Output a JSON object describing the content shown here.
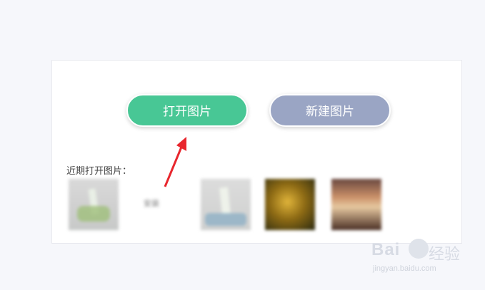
{
  "buttons": {
    "open_label": "打开图片",
    "open_color": "#48c795",
    "new_label": "新建图片",
    "new_color": "#9aa5c4"
  },
  "recent": {
    "label": "近期打开图片：",
    "items": [
      {
        "type": "image"
      },
      {
        "type": "text",
        "text": "安装"
      },
      {
        "type": "image"
      },
      {
        "type": "image"
      },
      {
        "type": "image"
      }
    ]
  },
  "annotation": {
    "arrow_color": "#e8262d"
  },
  "watermark": {
    "brand": "Bai",
    "brand_suffix": "经验",
    "url": "jingyan.baidu.com"
  }
}
